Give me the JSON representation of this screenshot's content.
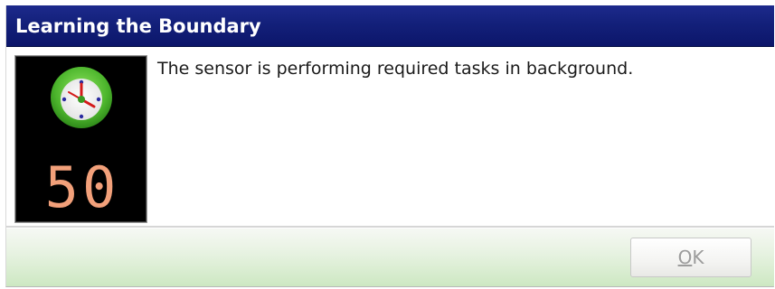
{
  "dialog": {
    "title": "Learning the Boundary",
    "message": "The sensor is performing required tasks in background.",
    "counter": "50",
    "icon": "clock-icon",
    "ok_label_mnemonic": "O",
    "ok_label_rest": "K",
    "ok_enabled": false
  },
  "colors": {
    "title_bar": "#13207a",
    "counter_digits": "#f2a07a",
    "clock_ring": "#5cc63a"
  }
}
